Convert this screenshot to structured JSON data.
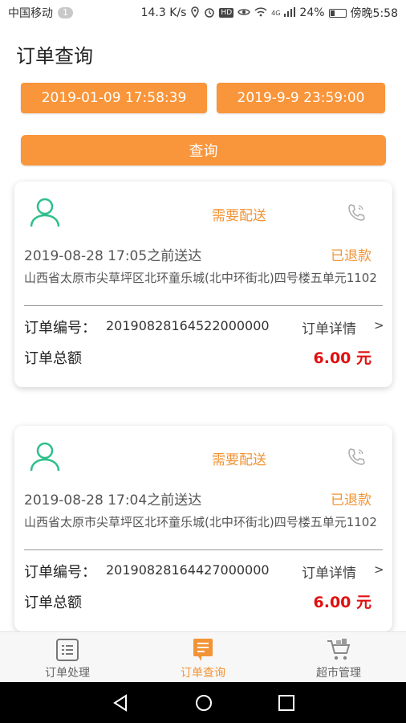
{
  "status_bar": {
    "carrier": "中国移动",
    "notif_count": "1",
    "speed": "14.3 K/s",
    "hd": "HD",
    "net": "4G",
    "battery": "24%",
    "time": "傍晚5:58"
  },
  "header": {
    "title": "订单查询"
  },
  "filter": {
    "start_date": "2019-01-09 17:58:39",
    "end_date": "2019-9-9 23:59:00",
    "query_label": "查询"
  },
  "orders": [
    {
      "delivery_type": "需要配送",
      "deadline": "2019-08-28 17:05之前送达",
      "status": "已退款",
      "address": "山西省太原市尖草坪区北环童乐城(北中环街北)四号楼五单元1102",
      "order_no_label": "订单编号：",
      "order_no": "20190828164522000000",
      "detail_label": "订单详情",
      "detail_arrow": ">",
      "total_label": "订单总额",
      "total_value": "6.00 元"
    },
    {
      "delivery_type": "需要配送",
      "deadline": "2019-08-28 17:04之前送达",
      "status": "已退款",
      "address": "山西省太原市尖草坪区北环童乐城(北中环街北)四号楼五单元1102",
      "order_no_label": "订单编号：",
      "order_no": "20190828164427000000",
      "detail_label": "订单详情",
      "detail_arrow": ">",
      "total_label": "订单总额",
      "total_value": "6.00 元"
    }
  ],
  "tabs": [
    {
      "label": "订单处理",
      "icon": "clipboard-icon"
    },
    {
      "label": "订单查询",
      "icon": "receipt-icon"
    },
    {
      "label": "超市管理",
      "icon": "cart-icon"
    }
  ],
  "colors": {
    "accent": "#f9953a",
    "price": "#e01010",
    "avatar": "#2fbf8a"
  }
}
